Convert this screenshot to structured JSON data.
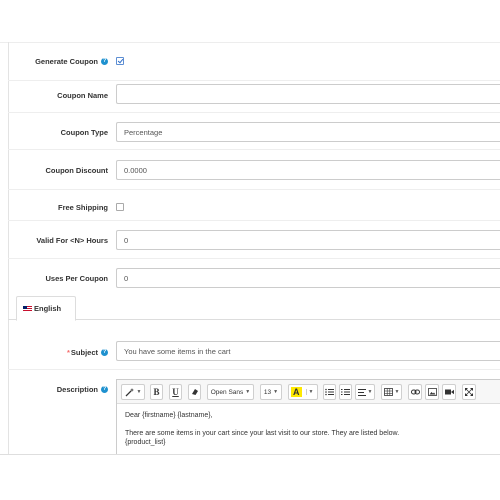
{
  "form": {
    "generate_coupon": {
      "label": "Generate Coupon",
      "checked": true
    },
    "coupon_name": {
      "label": "Coupon Name",
      "value": ""
    },
    "coupon_type": {
      "label": "Coupon Type",
      "value": "Percentage"
    },
    "coupon_discount": {
      "label": "Coupon Discount",
      "value": "0.0000"
    },
    "free_shipping": {
      "label": "Free Shipping",
      "checked": false
    },
    "valid_for_hours": {
      "label": "Valid For <N> Hours",
      "value": "0"
    },
    "uses_per_coupon": {
      "label": "Uses Per Coupon",
      "value": "0"
    }
  },
  "language_tabs": [
    {
      "label": "English",
      "active": true,
      "icon": "uk-flag-icon"
    }
  ],
  "email": {
    "subject": {
      "label": "Subject",
      "required": true,
      "value": "You have some items in the cart"
    },
    "description": {
      "label": "Description",
      "toolbar": {
        "font_name": "Open Sans",
        "font_size": "13",
        "highlight_letter": "A",
        "bold": "B",
        "underline": "U"
      },
      "body_lines": [
        "Dear {firstname} {lastname},",
        "There are some items in your cart since your last visit to our store. They are listed below.",
        "{product_list}"
      ]
    }
  },
  "colors": {
    "help_icon": "#1e91cf",
    "required_star": "#f56b6b",
    "highlight": "#ffe900"
  }
}
